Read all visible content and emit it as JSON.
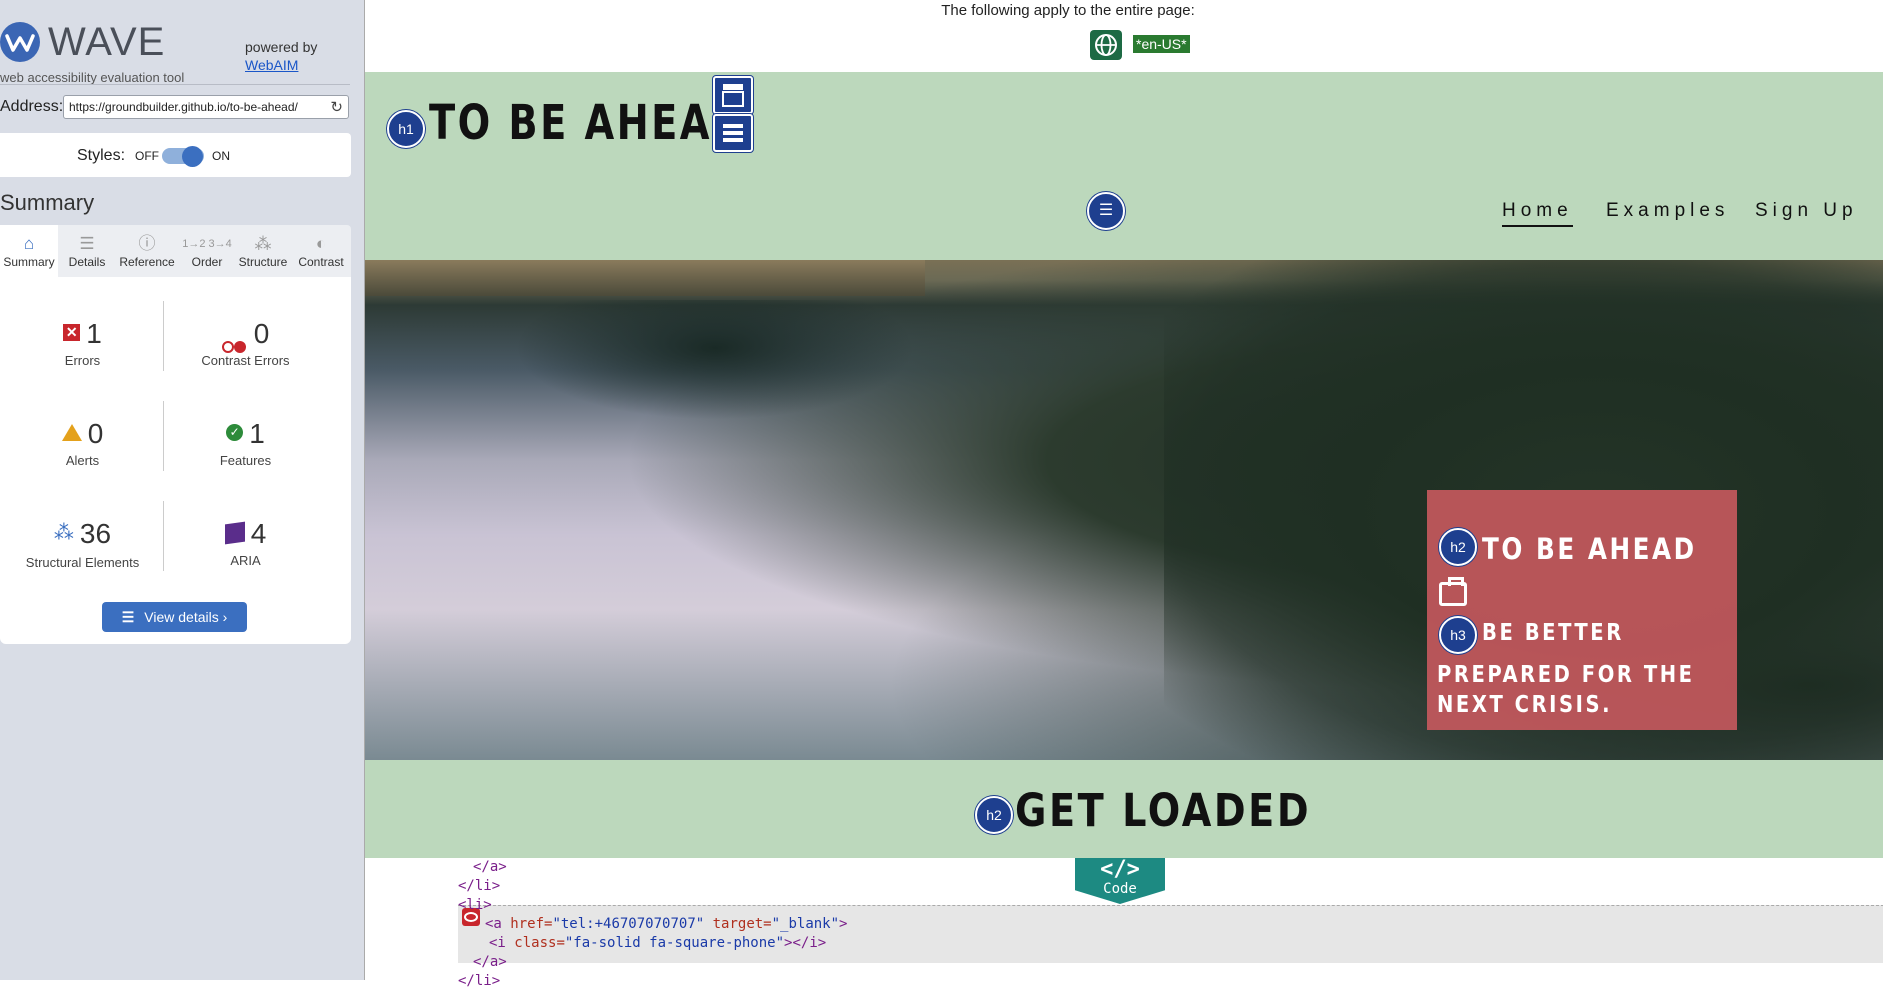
{
  "wave": {
    "name": "WAVE",
    "tagline": "web accessibility evaluation tool",
    "powered_by": "powered by",
    "webaim": "WebAIM",
    "address_label": "Address:",
    "address_value": "https://groundbuilder.github.io/to-be-ahead/",
    "styles_label": "Styles:",
    "styles_off": "OFF",
    "styles_on": "ON",
    "summary_title": "Summary",
    "tabs": [
      {
        "label": "Summary",
        "icon": "home-icon"
      },
      {
        "label": "Details",
        "icon": "list-icon"
      },
      {
        "label": "Reference",
        "icon": "info-icon"
      },
      {
        "label": "Order",
        "icon": "order-icon"
      },
      {
        "label": "Structure",
        "icon": "structure-icon"
      },
      {
        "label": "Contrast",
        "icon": "contrast-icon"
      }
    ],
    "stats": {
      "errors": {
        "count": "1",
        "label": "Errors"
      },
      "contrast_errors": {
        "count": "0",
        "label": "Contrast Errors"
      },
      "alerts": {
        "count": "0",
        "label": "Alerts"
      },
      "features": {
        "count": "1",
        "label": "Features"
      },
      "structural": {
        "count": "36",
        "label": "Structural Elements"
      },
      "aria": {
        "count": "4",
        "label": "ARIA"
      }
    },
    "view_details": "View details ›"
  },
  "preview": {
    "page_notice": "The following apply to the entire page:",
    "lang_badge": "*en-US*",
    "site_title": "TO BE AHEAD",
    "h1_badge": "h1",
    "nav": [
      "Home",
      "Examples",
      "Sign Up"
    ],
    "hero_h2_badge": "h2",
    "hero_title": "TO BE AHEAD",
    "hero_h3_badge": "h3",
    "hero_sub": "BE BETTER",
    "hero_text": "PREPARED FOR THE NEXT CRISIS.",
    "section_h2_badge": "h2",
    "section_title": "GET LOADED",
    "code_tab_glyph": "</>",
    "code_tab_label": "Code",
    "code": {
      "l1": "</a>",
      "l2": "</li>",
      "l3": "<li>",
      "l4_tag": "<a ",
      "l4_attr1": "href=",
      "l4_val1": "\"tel:+46707070707\"",
      "l4_attr2": " target=",
      "l4_val2": "\"_blank\"",
      "l4_end": ">",
      "l5_tag": "<i ",
      "l5_attr": "class=",
      "l5_val": "\"fa-solid fa-square-phone\"",
      "l5_end": "></i>",
      "l6": "</a>",
      "l7": "</li>"
    }
  },
  "colors": {
    "wave_blue": "#3b6fc0",
    "site_green": "#bcd8bc",
    "hero_card": "#cc5a60",
    "error_red": "#c8262c",
    "code_teal": "#1d8a82"
  }
}
